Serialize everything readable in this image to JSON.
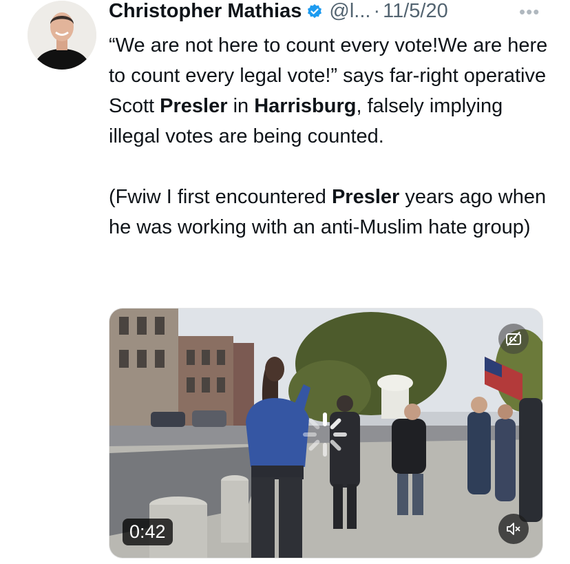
{
  "author": {
    "name": "Christopher Mathias",
    "handle": "@l...",
    "separator": "·",
    "date": "11/5/20",
    "verified_color": "#1d9bf0"
  },
  "tweet": {
    "p1_a": "“We are not here to count every vote!We are here to count every legal vote!” says far-right operative Scott ",
    "p1_b": "Presler",
    "p1_c": " in ",
    "p1_d": "Harrisburg",
    "p1_e": ", falsely implying illegal votes are being counted.",
    "p2_a": "(Fwiw I first encountered ",
    "p2_b": "Presler",
    "p2_c": " years ago when he was working with an anti-Muslim hate group)"
  },
  "media": {
    "duration": "0:42"
  },
  "icons": {
    "more": "more-icon",
    "verified": "verified-badge-icon",
    "captions": "captions-off-icon",
    "mute": "volume-muted-icon",
    "loading": "loading-spinner-icon"
  }
}
